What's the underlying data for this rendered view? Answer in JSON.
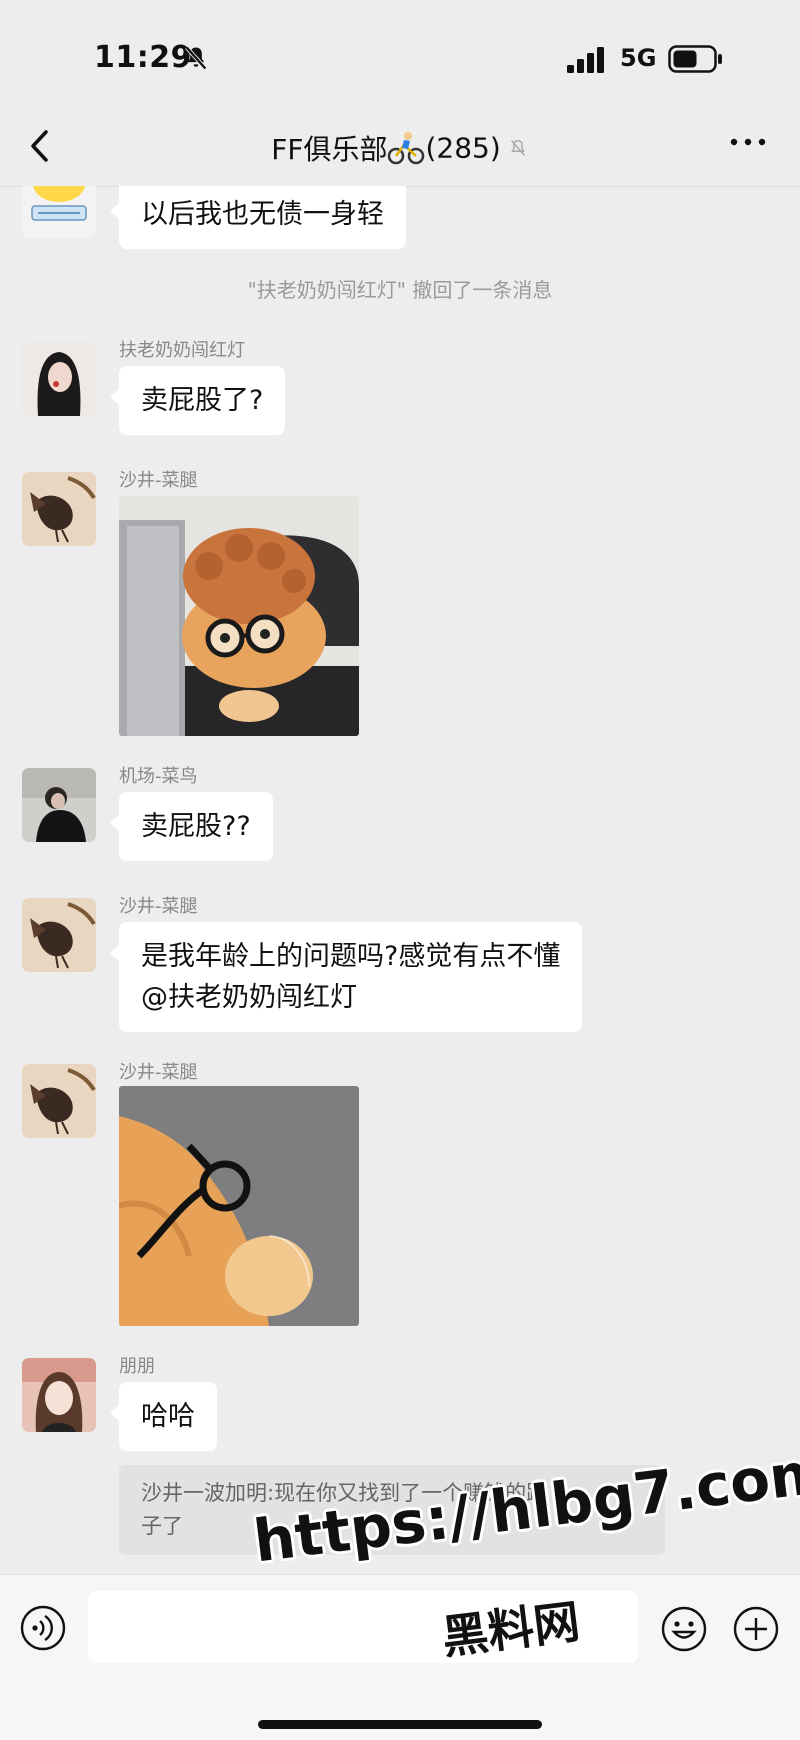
{
  "status": {
    "time": "11:29",
    "network": "5G"
  },
  "nav": {
    "title": "FF俱乐部",
    "member_count": "(285)"
  },
  "messages": [
    {
      "text": "以后我也无债一身轻"
    },
    {
      "system": "\"扶老奶奶闯红灯\" 撤回了一条消息"
    },
    {
      "sender": "扶老奶奶闯红灯",
      "text": "卖屁股了?"
    },
    {
      "sender": "沙井-菜腿",
      "image": "cat-with-wig-and-glasses"
    },
    {
      "sender": "机场-菜鸟",
      "text": "卖屁股??"
    },
    {
      "sender": "沙井-菜腿",
      "line1": "是我年龄上的问题吗?感觉有点不懂",
      "line2": "@扶老奶奶闯红灯"
    },
    {
      "sender": "沙井-菜腿",
      "image": "cat-closeup-with-glasses"
    },
    {
      "sender": "朋朋",
      "text": "哈哈",
      "quote_line1": "沙井一波加明:现在你又找到了一个赚钱的路",
      "quote_line2": "子了"
    }
  ],
  "watermark": {
    "url": "https://hlbg7.com",
    "label": "黑料网"
  },
  "colors": {
    "background": "#ededed",
    "bubble": "#ffffff",
    "quote": "#e2e2e2",
    "meta_text": "#888888"
  }
}
